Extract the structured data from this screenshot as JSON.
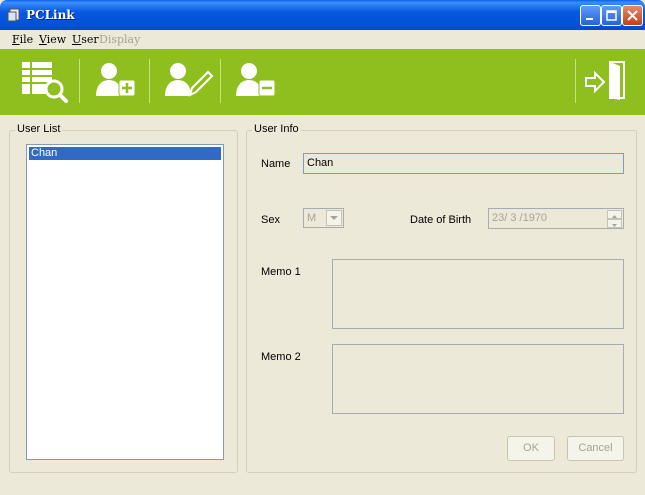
{
  "window": {
    "title": "PCLink"
  },
  "menu": {
    "file": "File",
    "view": "View",
    "user": "User",
    "display": "Display"
  },
  "toolbar": {
    "icons": [
      "list-search-icon",
      "add-user-icon",
      "edit-user-icon",
      "remove-user-icon",
      "exit-icon"
    ],
    "accent": "#8fbe1f"
  },
  "user_list": {
    "title": "User List",
    "items": [
      "Chan"
    ],
    "selected": "Chan"
  },
  "user_info": {
    "title": "User Info",
    "name_label": "Name",
    "name_value": "Chan",
    "sex_label": "Sex",
    "sex_value": "M",
    "dob_label": "Date of Birth",
    "dob_value": "23/ 3 /1970",
    "memo1_label": "Memo 1",
    "memo2_label": "Memo 2",
    "ok_label": "OK",
    "cancel_label": "Cancel"
  }
}
